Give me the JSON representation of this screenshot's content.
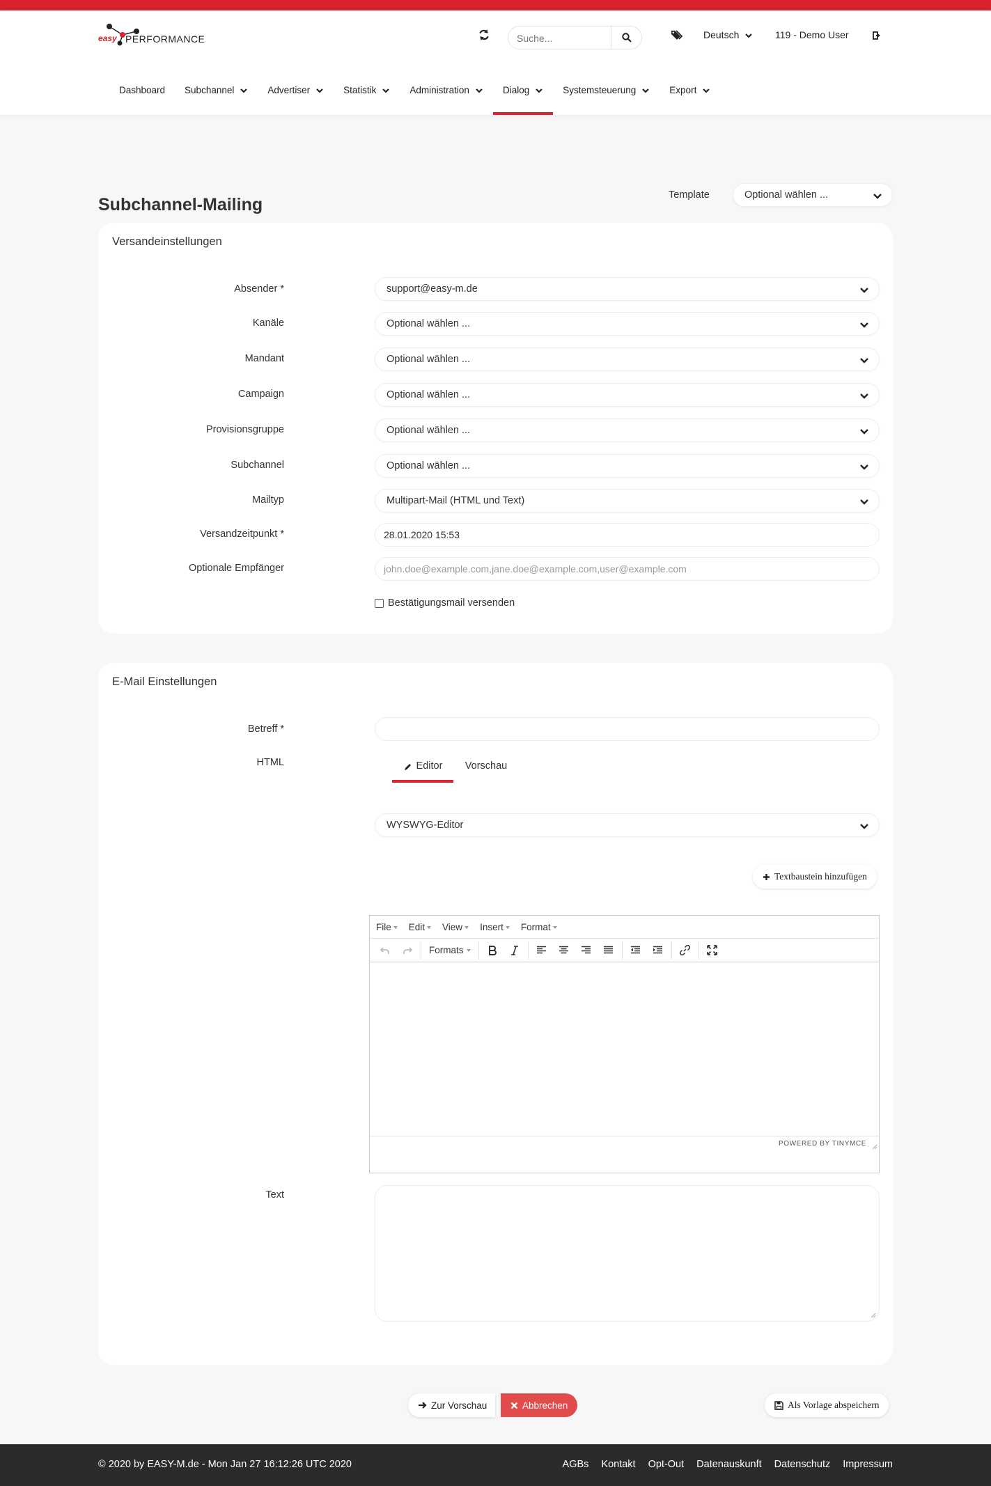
{
  "brand": {
    "logo_easy": "easy",
    "logo_text": "PERFORMANCE",
    "accent": "#d9232f"
  },
  "header": {
    "search_placeholder": "Suche...",
    "language": "Deutsch",
    "user": "119 - Demo User"
  },
  "nav": {
    "items": [
      {
        "label": "Dashboard"
      },
      {
        "label": "Subchannel"
      },
      {
        "label": "Advertiser"
      },
      {
        "label": "Statistik"
      },
      {
        "label": "Administration"
      },
      {
        "label": "Dialog"
      },
      {
        "label": "Systemsteuerung"
      },
      {
        "label": "Export"
      }
    ],
    "active": "Dialog"
  },
  "page": {
    "title": "Subchannel-Mailing",
    "template_label": "Template",
    "template_value": "Optional wählen ..."
  },
  "versand": {
    "title": "Versandeinstellungen",
    "fields": {
      "absender": {
        "label": "Absender *",
        "value": "support@easy-m.de"
      },
      "kanaele": {
        "label": "Kanäle",
        "value": "Optional wählen ..."
      },
      "mandant": {
        "label": "Mandant",
        "value": "Optional wählen ..."
      },
      "campaign": {
        "label": "Campaign",
        "value": "Optional wählen ..."
      },
      "provisionsgruppe": {
        "label": "Provisionsgruppe",
        "value": "Optional wählen ..."
      },
      "subchannel": {
        "label": "Subchannel",
        "value": "Optional wählen ..."
      },
      "mailtyp": {
        "label": "Mailtyp",
        "value": "Multipart-Mail (HTML und Text)"
      },
      "versandzeitpunkt": {
        "label": "Versandzeitpunkt *",
        "value": "28.01.2020 15:53"
      },
      "empfaenger": {
        "label": "Optionale Empfänger",
        "placeholder": "john.doe@example.com,jane.doe@example.com,user@example.com"
      }
    },
    "confirm_label": "Bestätigungsmail versenden"
  },
  "email": {
    "title": "E-Mail Einstellungen",
    "betreff_label": "Betreff *",
    "html_label": "HTML",
    "tab_editor": "Editor",
    "tab_preview": "Vorschau",
    "editor_type": "WYSWYG-Editor",
    "add_snippet": "Textbaustein hinzufügen",
    "text_label": "Text",
    "tinymce": {
      "menu": [
        "File",
        "Edit",
        "View",
        "Insert",
        "Format"
      ],
      "formats_label": "Formats",
      "powered_by": "POWERED BY TINYMCE"
    }
  },
  "actions": {
    "preview": "Zur Vorschau",
    "cancel": "Abbrechen",
    "save_template": "Als Vorlage abspeichern"
  },
  "footer": {
    "copyright": "© 2020 by EASY-M.de - Mon Jan 27 16:12:26 UTC 2020",
    "links": [
      "AGBs",
      "Kontakt",
      "Opt-Out",
      "Datenauskunft",
      "Datenschutz",
      "Impressum"
    ]
  }
}
